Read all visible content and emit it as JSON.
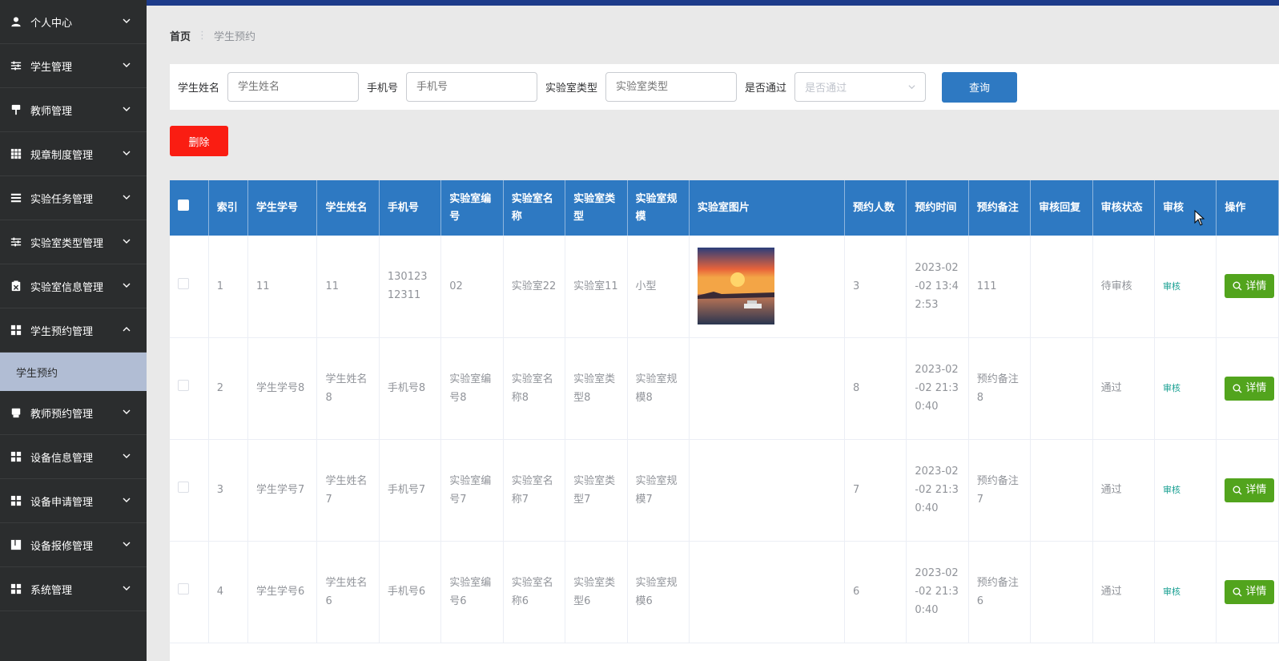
{
  "sidebar": {
    "items": [
      {
        "label": "个人中心",
        "icon": "user-icon",
        "expanded": false
      },
      {
        "label": "学生管理",
        "icon": "sliders-icon",
        "expanded": false
      },
      {
        "label": "教师管理",
        "icon": "paint-roller-icon",
        "expanded": false
      },
      {
        "label": "规章制度管理",
        "icon": "grid-icon",
        "expanded": false
      },
      {
        "label": "实验任务管理",
        "icon": "list-icon",
        "expanded": false
      },
      {
        "label": "实验室类型管理",
        "icon": "sliders-icon",
        "expanded": false
      },
      {
        "label": "实验室信息管理",
        "icon": "clipboard-x-icon",
        "expanded": false
      },
      {
        "label": "学生预约管理",
        "icon": "apps-icon",
        "expanded": true,
        "children": [
          "学生预约"
        ]
      },
      {
        "label": "教师预约管理",
        "icon": "laptop-icon",
        "expanded": false
      },
      {
        "label": "设备信息管理",
        "icon": "apps-icon",
        "expanded": false
      },
      {
        "label": "设备申请管理",
        "icon": "apps-icon",
        "expanded": false
      },
      {
        "label": "设备报修管理",
        "icon": "book-icon",
        "expanded": false
      },
      {
        "label": "系统管理",
        "icon": "apps-icon",
        "expanded": false
      }
    ]
  },
  "breadcrumb": {
    "home": "首页",
    "separator": "⋮",
    "current": "学生预约"
  },
  "search": {
    "fields": [
      {
        "label": "学生姓名",
        "placeholder": "学生姓名",
        "value": ""
      },
      {
        "label": "手机号",
        "placeholder": "手机号",
        "value": ""
      },
      {
        "label": "实验室类型",
        "placeholder": "实验室类型",
        "value": ""
      }
    ],
    "select": {
      "label": "是否通过",
      "placeholder": "是否通过"
    },
    "query_label": "查询"
  },
  "toolbar": {
    "delete_label": "删除"
  },
  "table": {
    "headers": [
      "",
      "索引",
      "学生学号",
      "学生姓名",
      "手机号",
      "实验室编号",
      "实验室名称",
      "实验室类型",
      "实验室规模",
      "实验室图片",
      "预约人数",
      "预约时间",
      "预约备注",
      "审核回复",
      "审核状态",
      "审核",
      "操作"
    ],
    "rows": [
      {
        "index": "1",
        "student_no": "11",
        "student_name": "11",
        "phone": "13012312311",
        "lab_no": "02",
        "lab_name": "实验室22",
        "lab_type": "实验室11",
        "lab_scale": "小型",
        "has_image": true,
        "count": "3",
        "time": "2023-02-02 13:42:53",
        "remark": "111",
        "reply": "",
        "status": "待审核",
        "audit": "审核",
        "action": "详情"
      },
      {
        "index": "2",
        "student_no": "学生学号8",
        "student_name": "学生姓名8",
        "phone": "手机号8",
        "lab_no": "实验室编号8",
        "lab_name": "实验室名称8",
        "lab_type": "实验室类型8",
        "lab_scale": "实验室规模8",
        "has_image": false,
        "count": "8",
        "time": "2023-02-02 21:30:40",
        "remark": "预约备注8",
        "reply": "",
        "status": "通过",
        "audit": "审核",
        "action": "详情"
      },
      {
        "index": "3",
        "student_no": "学生学号7",
        "student_name": "学生姓名7",
        "phone": "手机号7",
        "lab_no": "实验室编号7",
        "lab_name": "实验室名称7",
        "lab_type": "实验室类型7",
        "lab_scale": "实验室规模7",
        "has_image": false,
        "count": "7",
        "time": "2023-02-02 21:30:40",
        "remark": "预约备注7",
        "reply": "",
        "status": "通过",
        "audit": "审核",
        "action": "详情"
      },
      {
        "index": "4",
        "student_no": "学生学号6",
        "student_name": "学生姓名6",
        "phone": "手机号6",
        "lab_no": "实验室编号6",
        "lab_name": "实验室名称6",
        "lab_type": "实验室类型6",
        "lab_scale": "实验室规模6",
        "has_image": false,
        "count": "6",
        "time": "2023-02-02 21:30:40",
        "remark": "预约备注6",
        "reply": "",
        "status": "通过",
        "audit": "审核",
        "action": "详情"
      }
    ]
  },
  "colors": {
    "sidebar_bg": "#2b2d2e",
    "topbar": "#1d3b8a",
    "table_header": "#2e79c2",
    "delete": "#fa1d12",
    "detail": "#52a41d",
    "audit_link": "#1aa093",
    "submenu_active": "#b1bdd4"
  }
}
